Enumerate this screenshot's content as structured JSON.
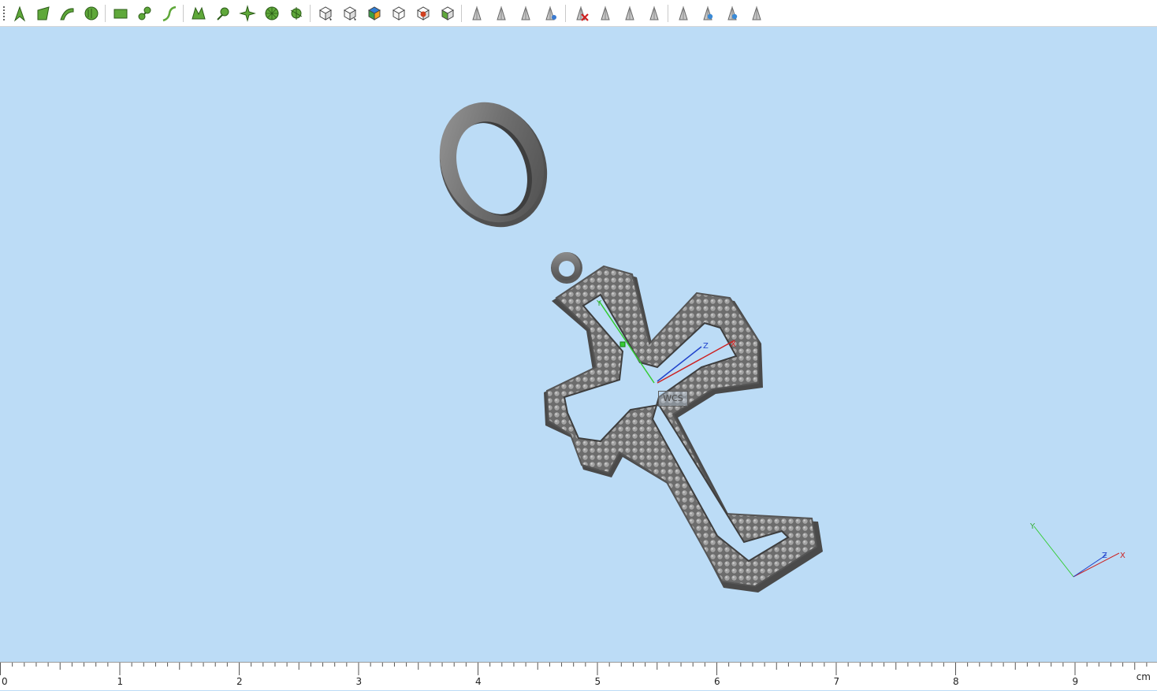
{
  "toolbar": {
    "tools": [
      {
        "icon": "select-arrow-icon"
      },
      {
        "icon": "select-face-icon"
      },
      {
        "icon": "select-curve-icon"
      },
      {
        "icon": "select-lasso-icon"
      },
      {
        "icon": "select-rectangle-icon"
      },
      {
        "icon": "select-chain-icon"
      },
      {
        "icon": "select-path-icon"
      },
      {
        "icon": "select-mesh-icon"
      },
      {
        "icon": "select-node-icon"
      },
      {
        "icon": "select-pattern-icon"
      },
      {
        "icon": "select-circle-icon"
      },
      {
        "icon": "select-wheel-icon"
      },
      {
        "icon": "solid-cube-icon"
      },
      {
        "icon": "shaded-cube-icon"
      },
      {
        "icon": "colored-cube-icon"
      },
      {
        "icon": "wireframe-cube-icon"
      },
      {
        "icon": "sphere-cube-icon"
      },
      {
        "icon": "box-add-icon"
      },
      {
        "icon": "pointer-a-icon"
      },
      {
        "icon": "pointer-b-icon"
      },
      {
        "icon": "pointer-c-icon"
      },
      {
        "icon": "pointer-d-icon"
      },
      {
        "icon": "delete-red-icon"
      },
      {
        "icon": "grey-tool-a-icon"
      },
      {
        "icon": "grey-tool-b-icon"
      },
      {
        "icon": "grey-tool-c-icon"
      },
      {
        "icon": "view-tool-a-icon"
      },
      {
        "icon": "view-tool-b-icon"
      },
      {
        "icon": "view-tool-c-icon"
      },
      {
        "icon": "view-tool-d-icon"
      }
    ]
  },
  "viewport": {
    "background": "#bcdcf6",
    "model_color": "#7a7a7a",
    "wcs_label": "WCS",
    "local_axes": {
      "x": "X",
      "y": "Y",
      "z": "Z"
    },
    "corner_axes": {
      "x": "X",
      "y": "Y",
      "z": "Z"
    }
  },
  "ruler": {
    "labels": [
      "0",
      "1",
      "2",
      "3",
      "4",
      "5",
      "6",
      "7",
      "8",
      "9"
    ],
    "unit": "cm"
  }
}
